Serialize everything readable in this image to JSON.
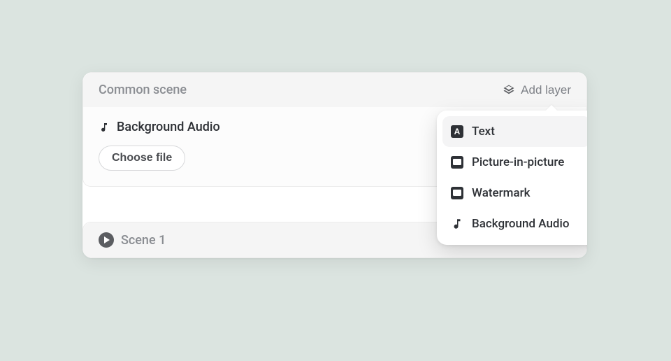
{
  "commonScene": {
    "title": "Common scene",
    "addLayerLabel": "Add layer",
    "layers": [
      {
        "label": "Background Audio"
      }
    ],
    "chooseFileLabel": "Choose file"
  },
  "scene1": {
    "title": "Scene 1"
  },
  "addLayerMenu": {
    "items": [
      {
        "label": "Text"
      },
      {
        "label": "Picture-in-picture"
      },
      {
        "label": "Watermark"
      },
      {
        "label": "Background Audio"
      }
    ]
  }
}
